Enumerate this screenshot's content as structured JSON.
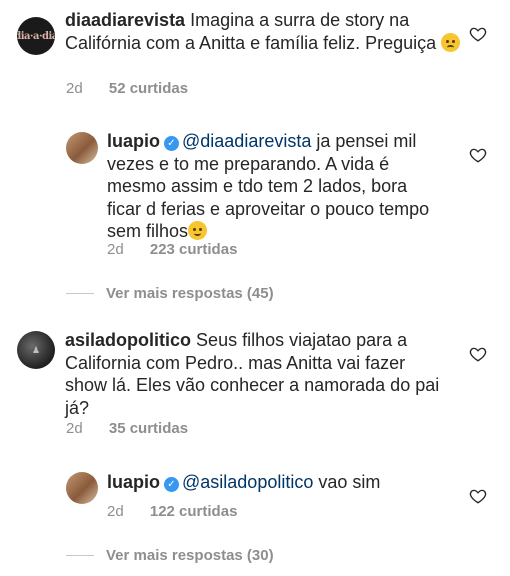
{
  "comments": [
    {
      "username": "diaadiarevista",
      "text": "Imagina a surra de story na Califórnia com a Anitta e família feliz. Preguiça",
      "emoji": "persevering-face-emoji",
      "time": "2d",
      "likes": "52 curtidas",
      "avatar_text": "dia·a·dia"
    },
    {
      "username": "luapio",
      "verified": true,
      "mention": "@diaadiarevista",
      "text": "ja pensei mil vezes e to me preparando. A vida é mesmo assim e tdo tem 2 lados, bora ficar d ferias e aproveitar o pouco tempo sem filhos",
      "emoji": "smirking-face-emoji",
      "time": "2d",
      "likes": "223 curtidas"
    },
    {
      "username": "asiladopolitico",
      "text": "Seus filhos viajatao para a California com Pedro.. mas Anitta vai fazer show lá. Eles vão  conhecer a namorada do pai já?",
      "time": "2d",
      "likes": "35 curtidas"
    },
    {
      "username": "luapio",
      "verified": true,
      "mention": "@asiladopolitico",
      "text": "vao sim",
      "time": "2d",
      "likes": "122 curtidas"
    }
  ],
  "view_more_1": "Ver mais respostas (45)",
  "view_more_2": "Ver mais respostas (30)",
  "icons": {
    "like": "heart-outline-icon",
    "verified": "verified-badge-icon"
  },
  "colors": {
    "text": "#262626",
    "meta": "#8e8e8e",
    "mention": "#003569",
    "verified": "#3897f0"
  }
}
